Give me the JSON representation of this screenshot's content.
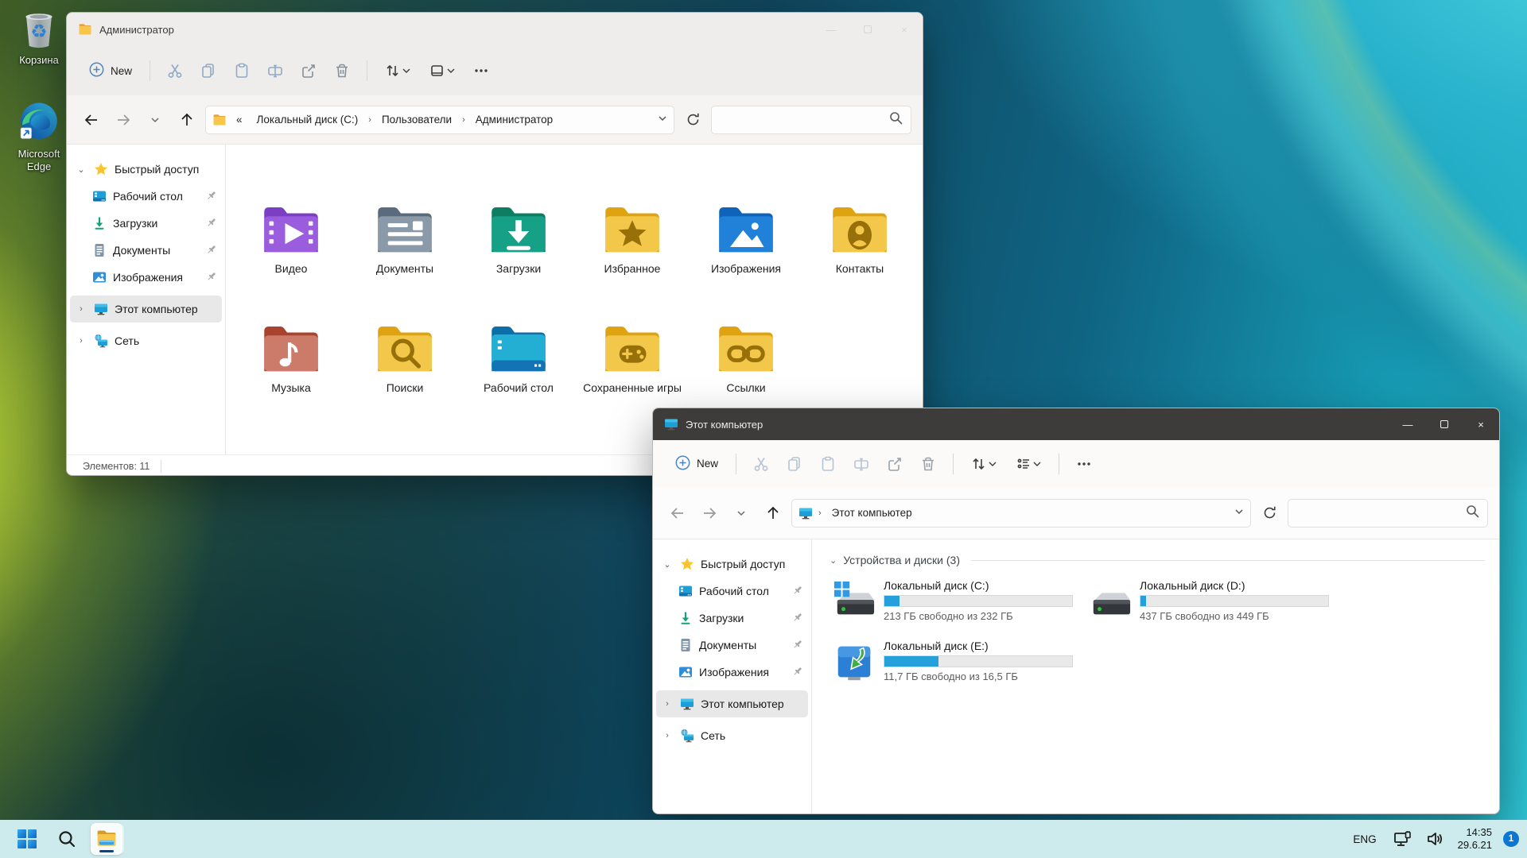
{
  "desktop": {
    "icons": [
      {
        "id": "recycle-bin",
        "label": "Корзина"
      },
      {
        "id": "edge",
        "label": "Microsoft Edge"
      }
    ]
  },
  "shared": {
    "toolbar": {
      "new_label": "New"
    },
    "sidebar": {
      "quick_access": "Быстрый доступ",
      "pinned": [
        {
          "label": "Рабочий стол",
          "icon": "desktop"
        },
        {
          "label": "Загрузки",
          "icon": "downloads"
        },
        {
          "label": "Документы",
          "icon": "documents"
        },
        {
          "label": "Изображения",
          "icon": "pictures"
        }
      ],
      "computer": "Этот компьютер",
      "network": "Сеть"
    }
  },
  "window1": {
    "title": "Администратор",
    "breadcrumb": {
      "overflow": "«",
      "items": [
        "Локальный диск (C:)",
        "Пользователи",
        "Администратор"
      ]
    },
    "files": [
      {
        "label": "Видео",
        "icon": "video"
      },
      {
        "label": "Документы",
        "icon": "documents"
      },
      {
        "label": "Загрузки",
        "icon": "downloads"
      },
      {
        "label": "Избранное",
        "icon": "favorites"
      },
      {
        "label": "Изображения",
        "icon": "pictures"
      },
      {
        "label": "Контакты",
        "icon": "contacts"
      },
      {
        "label": "Музыка",
        "icon": "music"
      },
      {
        "label": "Поиски",
        "icon": "search"
      },
      {
        "label": "Рабочий стол",
        "icon": "desktop"
      },
      {
        "label": "Сохраненные игры",
        "icon": "games"
      },
      {
        "label": "Ссылки",
        "icon": "links"
      }
    ],
    "status": "Элементов: 11"
  },
  "window2": {
    "title": "Этот компьютер",
    "breadcrumb": {
      "items": [
        "Этот компьютер"
      ]
    },
    "section_title": "Устройства и диски (3)",
    "drives": [
      {
        "name": "Локальный диск (C:)",
        "free_text": "213 ГБ свободно из 232 ГБ",
        "used_percent": 8,
        "icon": "hdd-system"
      },
      {
        "name": "Локальный диск (D:)",
        "free_text": "437 ГБ свободно из 449 ГБ",
        "used_percent": 3,
        "icon": "hdd"
      },
      {
        "name": "Локальный диск (E:)",
        "free_text": "11,7 ГБ свободно из 16,5 ГБ",
        "used_percent": 29,
        "icon": "drive-e"
      }
    ]
  },
  "taskbar": {
    "lang": "ENG",
    "time": "14:35",
    "date": "29.6.21",
    "badge_count": "1"
  },
  "colors": {
    "accent_blue": "#0b77d0",
    "progress_fill": "#26a0da",
    "taskbar_bg": "#cdeaec",
    "win2_titlebar": "#3e3c3b",
    "selection_gray": "#e9e8e8"
  }
}
